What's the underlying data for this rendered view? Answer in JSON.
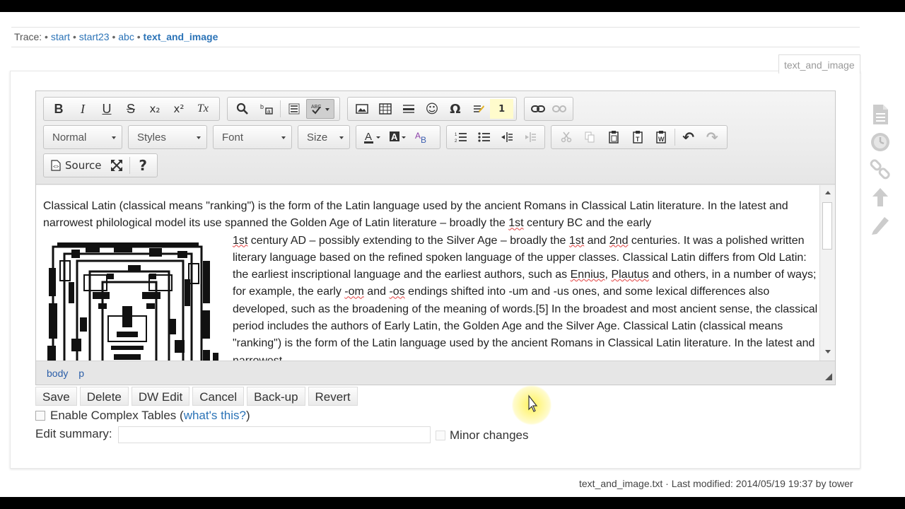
{
  "breadcrumb": {
    "label": "Trace:",
    "items": [
      "start",
      "start23",
      "abc"
    ],
    "current": "text_and_image",
    "separator": "•"
  },
  "page_tab": "text_and_image",
  "toolbar": {
    "row1_icons": [
      "bold-icon",
      "italic-icon",
      "underline-icon",
      "strikethrough-icon",
      "subscript-icon",
      "superscript-icon",
      "remove-format-icon",
      "find-icon",
      "replace-icon",
      "select-all-icon",
      "spellcheck-icon",
      "image-icon",
      "table-icon",
      "horizontal-rule-icon",
      "smiley-icon",
      "special-char-icon",
      "footnote-icon",
      "footnote-number-icon",
      "link-icon",
      "unlink-icon"
    ],
    "format_combo": "Normal",
    "styles_combo": "Styles",
    "font_combo": "Font",
    "size_combo": "Size",
    "source_label": "Source",
    "glyphs": {
      "bold": "B",
      "italic": "I",
      "underline": "U",
      "strike": "S",
      "subscript": "x₂",
      "superscript": "x²",
      "clear": "Tx",
      "omega": "Ω",
      "smiley": "☺",
      "footnote": "1",
      "help": "?",
      "undo": "↶",
      "redo": "↷"
    }
  },
  "content": {
    "line1": "Classical Latin (classical means \"ranking\") is the form of the Latin language used by the ancient Romans in Classical Latin literature. In the latest and narrowest philological model its use spanned the Golden Age of Latin literature – broadly the ",
    "w1": "1st",
    "t1": " century BC and the early ",
    "w2": "1st",
    "t2": " century AD – possibly extending to the Silver Age – broadly the ",
    "w3": "1st",
    "t3": " and ",
    "w4": "2nd",
    "t4": " centuries. It was a polished written literary language based on the refined spoken language of the upper classes. Classical Latin differs from Old Latin: the earliest inscriptional language and the earliest authors, such as ",
    "w5": "Ennius",
    "t5": ", ",
    "w6": "Plautus",
    "t6": " and others, in a number of ways; for example, the early ",
    "w7": "-om",
    "t7": " and ",
    "w8": "-os",
    "t8": " endings shifted into -um and -us ones, and some lexical differences also developed, such as the broadening of the meaning of words.[5] In the broadest and most ancient sense, the classical period includes the authors of Early Latin, the Golden Age and the Silver Age. Classical Latin (classical means \"ranking\") is the form of the Latin language used by the ancient Romans in Classical Latin literature. In the latest and narrowest"
  },
  "pathbar": [
    "body",
    "p"
  ],
  "buttons": [
    "Save",
    "Delete",
    "DW Edit",
    "Cancel",
    "Back-up",
    "Revert"
  ],
  "complex_tables": {
    "label": "Enable Complex Tables",
    "paren_open": " (",
    "link": "what's this?",
    "paren_close": ")"
  },
  "summary": {
    "label": "Edit summary:",
    "value": "",
    "minor_label": "Minor changes"
  },
  "footer": "text_and_image.txt · Last modified: 2014/05/19 19:37 by tower",
  "sidebar_icons": [
    "page-icon",
    "history-icon",
    "backlinks-icon",
    "back-to-top-icon",
    "edit-pencil-icon"
  ],
  "colors": {
    "link": "#2b73b7",
    "toolbar_bg": "#e9e9e9",
    "cursor_highlight": "#fff03c"
  }
}
